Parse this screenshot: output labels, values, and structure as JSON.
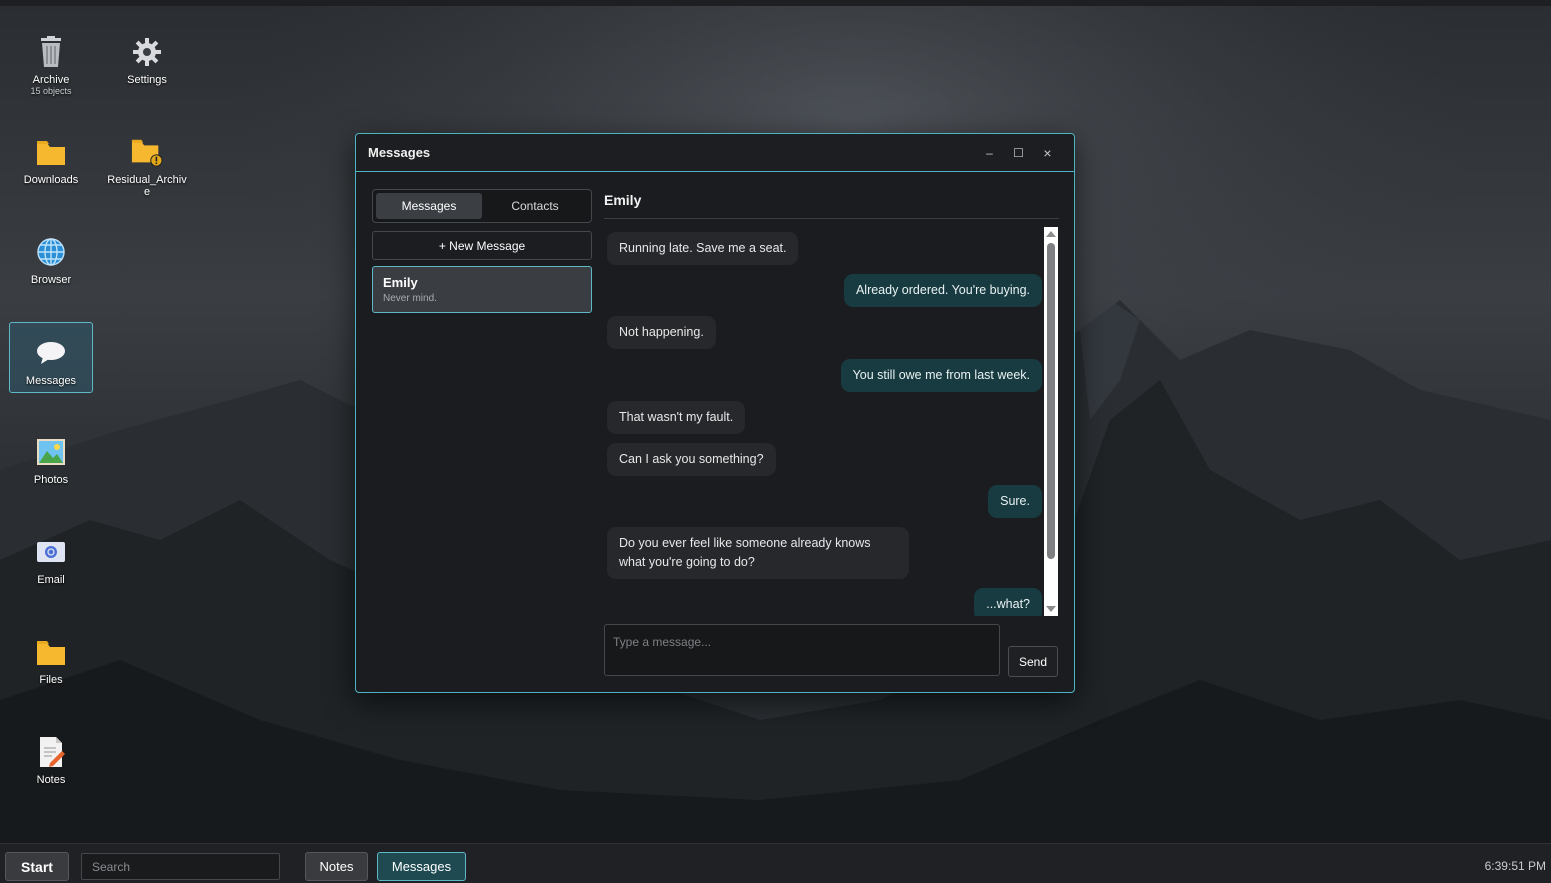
{
  "desktop": {
    "icons": [
      {
        "label": "Archive",
        "sub": "15 objects",
        "icon": "trash-icon"
      },
      {
        "label": "Settings",
        "icon": "gear-icon"
      },
      {
        "label": "Downloads",
        "icon": "folder-icon"
      },
      {
        "label": "Residual_Archive",
        "icon": "folder-warning-icon"
      },
      {
        "label": "Browser",
        "icon": "globe-icon"
      },
      {
        "label": "Messages",
        "icon": "chat-bubble-icon"
      },
      {
        "label": "Photos",
        "icon": "image-icon"
      },
      {
        "label": "Email",
        "icon": "email-icon"
      },
      {
        "label": "Files",
        "icon": "folder-icon"
      },
      {
        "label": "Notes",
        "icon": "notes-icon"
      }
    ]
  },
  "window": {
    "title": "Messages",
    "controls": {
      "minimize": "–",
      "maximize": "☐",
      "close": "×"
    },
    "tabs": [
      {
        "label": "Messages",
        "active": true
      },
      {
        "label": "Contacts",
        "active": false
      }
    ],
    "new_message_label": "+ New Message",
    "conversations": [
      {
        "name": "Emily",
        "preview": "Never mind.",
        "selected": true
      }
    ],
    "chat": {
      "contact": "Emily",
      "messages": [
        {
          "from": "them",
          "text": "Running late. Save me a seat."
        },
        {
          "from": "me",
          "text": "Already ordered. You're buying."
        },
        {
          "from": "them",
          "text": "Not happening."
        },
        {
          "from": "me",
          "text": "You still owe me from last week."
        },
        {
          "from": "them",
          "text": "That wasn't my fault."
        },
        {
          "from": "them",
          "text": "Can I ask you something?"
        },
        {
          "from": "me",
          "text": "Sure."
        },
        {
          "from": "them",
          "text": "Do you ever feel like someone already knows what you're going to do?"
        },
        {
          "from": "me",
          "text": "...what?"
        }
      ],
      "input_placeholder": "Type a message...",
      "send_label": "Send"
    }
  },
  "taskbar": {
    "start_label": "Start",
    "search_placeholder": "Search",
    "apps": [
      {
        "label": "Notes",
        "active": false
      },
      {
        "label": "Messages",
        "active": true
      }
    ],
    "clock": "6:39:51 PM"
  },
  "colors": {
    "accent": "#5fb8c8",
    "bubble_me": "#173b40",
    "bubble_them": "#26282c"
  }
}
